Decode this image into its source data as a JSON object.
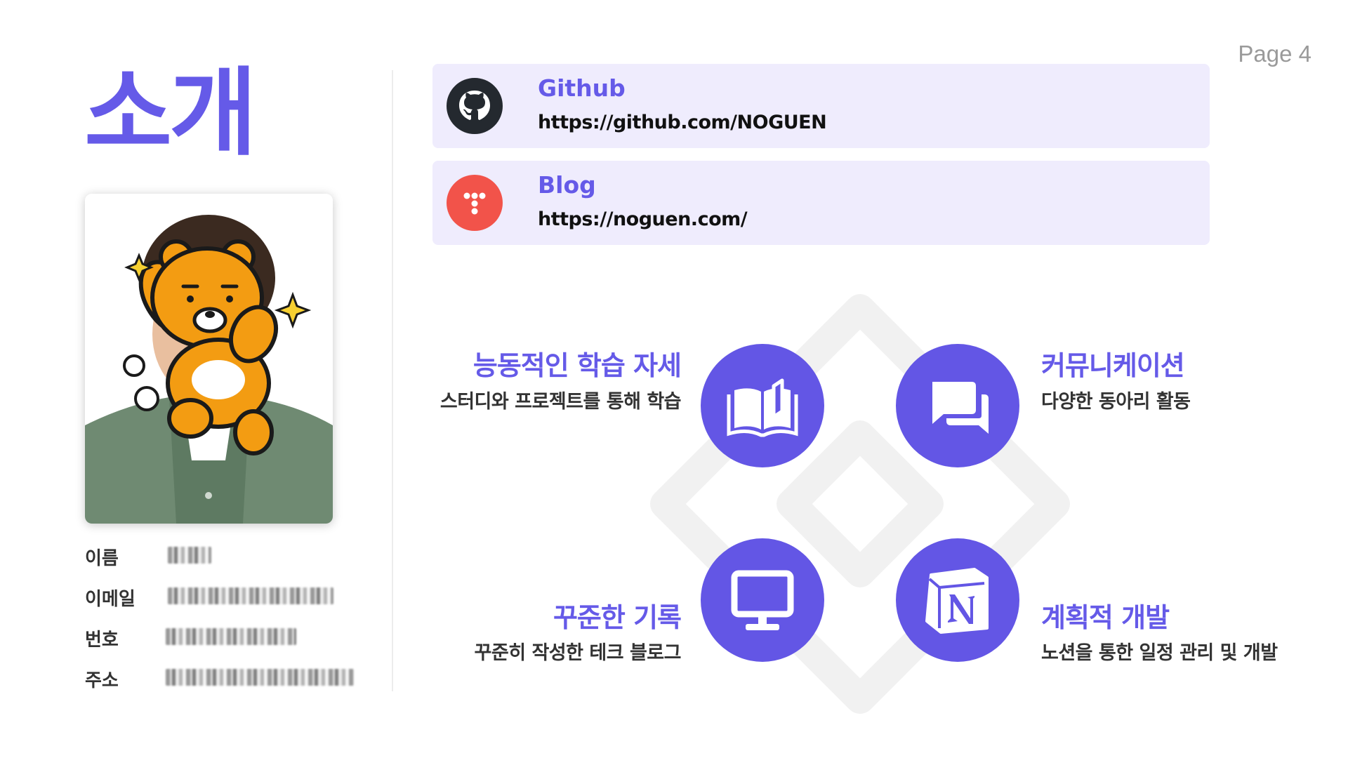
{
  "page": {
    "number_label": "Page 4"
  },
  "title": "소개",
  "profile": {
    "fields": [
      {
        "label": "이름"
      },
      {
        "label": "이메일"
      },
      {
        "label": "번호"
      },
      {
        "label": "주소"
      }
    ]
  },
  "links": [
    {
      "name": "Github",
      "url": "https://github.com/NOGUEN",
      "icon": "github-icon"
    },
    {
      "name": "Blog",
      "url": "https://noguen.com/",
      "icon": "tistory-icon"
    }
  ],
  "features": [
    {
      "title": "능동적인 학습 자세",
      "desc": "스터디와 프로젝트를 통해 학습",
      "icon": "book-icon"
    },
    {
      "title": "커뮤니케이션",
      "desc": "다양한 동아리 활동",
      "icon": "chat-icon"
    },
    {
      "title": "꾸준한 기록",
      "desc": "꾸준히 작성한 테크 블로그",
      "icon": "monitor-icon"
    },
    {
      "title": "계획적 개발",
      "desc": "노션을 통한 일정 관리 및 개발",
      "icon": "notion-icon"
    }
  ],
  "colors": {
    "accent": "#655ae8",
    "circle": "#6356e5",
    "card_bg": "#efecfd",
    "blog_icon": "#f2534a"
  }
}
